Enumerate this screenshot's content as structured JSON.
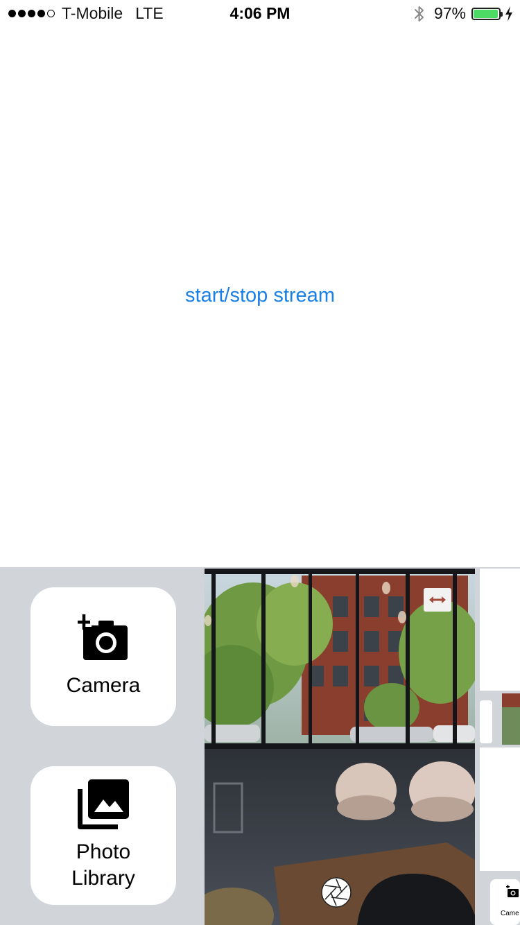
{
  "status_bar": {
    "carrier": "T-Mobile",
    "network": "LTE",
    "time": "4:06 PM",
    "battery_percent": "97%",
    "battery_level": 0.97,
    "signal_bars_filled": 4,
    "signal_bars_total": 5,
    "icons": [
      "bluetooth-icon",
      "battery-icon",
      "charging-bolt-icon"
    ]
  },
  "main": {
    "stream_button_label": "start/stop stream"
  },
  "picker": {
    "camera_label": "Camera",
    "library_label_line1": "Photo",
    "library_label_line2": "Library",
    "icons": [
      "add-camera-icon",
      "photo-library-icon",
      "flip-camera-icon",
      "shutter-icon"
    ],
    "strip_partial_label": "Came"
  },
  "colors": {
    "link": "#1a7fe6",
    "panel_bg": "#d1d4d9",
    "battery_green": "#4cd964"
  }
}
